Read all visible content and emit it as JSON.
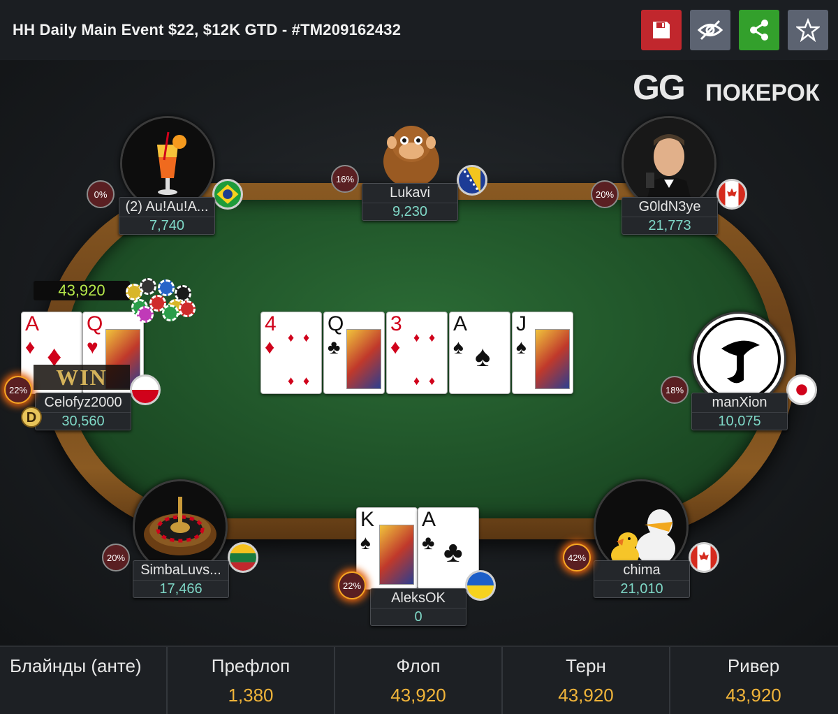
{
  "header": {
    "title": "HH Daily Main Event $22, $12K GTD - #TM209162432",
    "buttons": [
      {
        "name": "save",
        "icon": "floppy-disk-icon",
        "color": "#c1272d"
      },
      {
        "name": "hide",
        "icon": "eye-off-icon",
        "color": "#5c6371"
      },
      {
        "name": "share",
        "icon": "share-icon",
        "color": "#33a02c"
      },
      {
        "name": "favorite",
        "icon": "star-icon",
        "color": "#5c6371"
      }
    ]
  },
  "logo": {
    "main": "GG",
    "sub": "ПОКЕРОК"
  },
  "players": [
    {
      "name": "(2) Au!Au!A...",
      "stack": "7,740",
      "pct": "0%",
      "flag": "brazil",
      "avatar": "cocktail-avatar",
      "hot": false
    },
    {
      "name": "Lukavi",
      "stack": "9,230",
      "pct": "16%",
      "flag": "bosnia",
      "avatar": "monkey-avatar",
      "hot": false
    },
    {
      "name": "G0ldN3ye",
      "stack": "21,773",
      "pct": "20%",
      "flag": "canada",
      "avatar": "agent-avatar",
      "hot": false
    },
    {
      "name": "manXion",
      "stack": "10,075",
      "pct": "18%",
      "flag": "japan",
      "avatar": "logo-avatar",
      "hot": false
    },
    {
      "name": "chima",
      "stack": "21,010",
      "pct": "42%",
      "flag": "canada",
      "avatar": "ducks-avatar",
      "hot": true
    },
    {
      "name": "AleksOK",
      "stack": "0",
      "pct": "22%",
      "flag": "ukraine",
      "avatar": "cards-avatar",
      "hot": true
    },
    {
      "name": "SimbaLuvs...",
      "stack": "17,466",
      "pct": "20%",
      "flag": "lithuania",
      "avatar": "roulette-avatar",
      "hot": false
    },
    {
      "name": "Celofyz2000",
      "stack": "30,560",
      "pct": "22%",
      "flag": "poland",
      "avatar": "cards-avatar",
      "hot": true
    }
  ],
  "winner": {
    "amount": "43,920",
    "badge": "WIN",
    "dealer": "D"
  },
  "board": [
    {
      "rank": "4",
      "suit": "♦",
      "color": "red"
    },
    {
      "rank": "Q",
      "suit": "♣",
      "color": "black"
    },
    {
      "rank": "3",
      "suit": "♦",
      "color": "red"
    },
    {
      "rank": "A",
      "suit": "♠",
      "color": "black"
    },
    {
      "rank": "J",
      "suit": "♠",
      "color": "black"
    }
  ],
  "hero_cards": [
    {
      "rank": "K",
      "suit": "♠",
      "color": "black"
    },
    {
      "rank": "A",
      "suit": "♣",
      "color": "black"
    }
  ],
  "winner_cards": [
    {
      "rank": "A",
      "suit": "♦",
      "color": "red"
    },
    {
      "rank": "Q",
      "suit": "♥",
      "color": "red"
    }
  ],
  "streets": [
    {
      "label": "Блайнды (анте)",
      "value": ""
    },
    {
      "label": "Префлоп",
      "value": "1,380"
    },
    {
      "label": "Флоп",
      "value": "43,920"
    },
    {
      "label": "Терн",
      "value": "43,920"
    },
    {
      "label": "Ривер",
      "value": "43,920"
    }
  ]
}
